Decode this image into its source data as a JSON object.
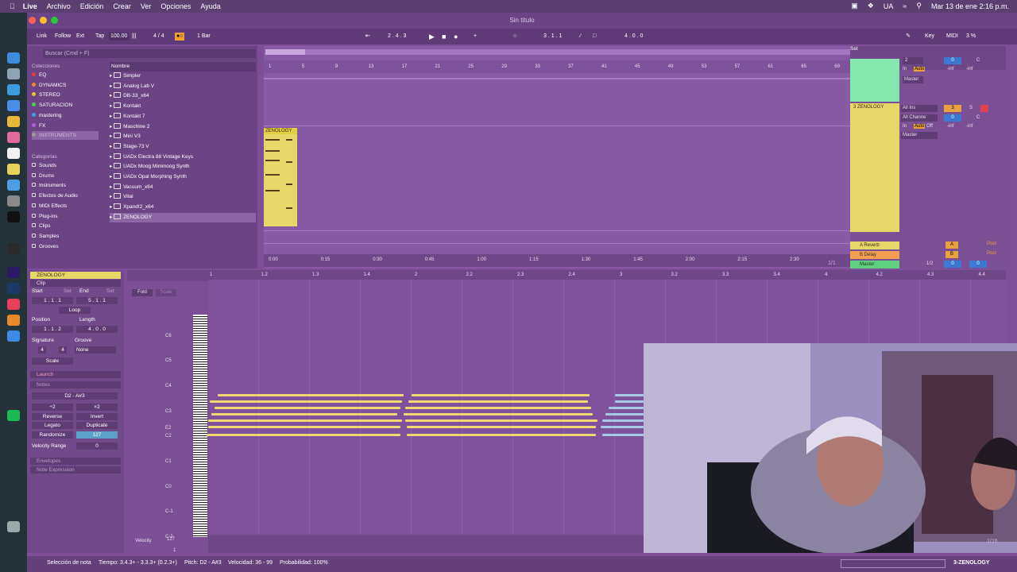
{
  "menubar": {
    "app": "Live",
    "items": [
      "Archivo",
      "Edición",
      "Crear",
      "Ver",
      "Opciones",
      "Ayuda"
    ],
    "status_lang": "UA",
    "datetime": "Mar 13 de ene  2:16 p.m."
  },
  "window": {
    "title": "Sin título"
  },
  "transport": {
    "link": "Link",
    "follow": "Follow",
    "ext": "Ext",
    "tap": "Tap",
    "tempo": "100.00",
    "signature": "4 / 4",
    "quantize": "1 Bar",
    "position": "2 .  4 .  3",
    "loop_start": "3 .  1 .  1",
    "loop_length": "4 .  0 .  0",
    "key": "Key",
    "midi": "MIDI",
    "cpu": "3 %"
  },
  "browser": {
    "search_placeholder": "Buscar (Cmd + F)",
    "collections_title": "Colecciones",
    "collections": [
      {
        "label": "EQ",
        "color": "#e43b3b"
      },
      {
        "label": "DYNAMICS",
        "color": "#f08a2a"
      },
      {
        "label": "STEREO",
        "color": "#e8c92a"
      },
      {
        "label": "SATURACION",
        "color": "#4ccf4c"
      },
      {
        "label": "mastering",
        "color": "#3aa0e8"
      },
      {
        "label": "FX",
        "color": "#b05ce0"
      },
      {
        "label": "INSTRUMENTS",
        "color": "#999999"
      }
    ],
    "categories_title": "Categorías",
    "categories": [
      "Sounds",
      "Drums",
      "Instruments",
      "Efectos de Audio",
      "MIDI Effects",
      "Plug-ins",
      "Clips",
      "Samples",
      "Grooves"
    ],
    "name_header": "Nombre",
    "items": [
      "Simpler",
      "Analog Lab V",
      "DB-33_x64",
      "Kontakt",
      "Kontakt 7",
      "Maschine 2",
      "Mini V3",
      "Stage-73 V",
      "UADx Electra 88 Vintage Keys",
      "UADx Moog Minimoog Synth",
      "UADx Opal Morphing Synth",
      "Vacuum_x64",
      "Vital",
      "Xpand!2_x64",
      "ZENOLOGY"
    ]
  },
  "arrangement": {
    "bar_numbers": [
      "1",
      "5",
      "9",
      "13",
      "17",
      "21",
      "25",
      "29",
      "33",
      "37",
      "41",
      "45",
      "49",
      "53",
      "57",
      "61",
      "65",
      "69"
    ],
    "clip_name": "ZENOLOGY",
    "time_labels": [
      "0:00",
      "0:15",
      "0:30",
      "0:45",
      "1:00",
      "1:15",
      "1:30",
      "1:45",
      "2:00",
      "2:15",
      "2:30"
    ],
    "set_label": "Set",
    "page": "1/1"
  },
  "mixer": {
    "track2": {
      "num": "2",
      "out": "Master",
      "in": "In",
      "auto": "Auto",
      "off": "Off",
      "vol": "0",
      "pan": "C",
      "inf1": "-inf",
      "inf2": "-inf"
    },
    "track3": {
      "name": "3 ZENOLOGY",
      "input": "All Ins",
      "channel": "All Channe",
      "out": "Master",
      "num": "3",
      "solo": "S",
      "vol": "0",
      "pan": "C",
      "in": "In",
      "auto": "Auto",
      "off": "Off",
      "inf1": "-inf",
      "inf2": "-inf"
    },
    "returns": [
      {
        "name": "A Reverb",
        "letter": "A",
        "post": "Post"
      },
      {
        "name": "B Delay",
        "letter": "B",
        "post": "Post"
      }
    ],
    "master": {
      "name": "Master",
      "ratio": "1/2",
      "vol": "0",
      "pan": "0"
    }
  },
  "clip": {
    "name": "ZENOLOGY",
    "section": "Clip",
    "start": "Start",
    "end": "End",
    "set": "Set",
    "start_val": "1 .  1 .  1",
    "end_val": "5 .  1 .  1",
    "loop": "Loop",
    "position": "Position",
    "length": "Length",
    "pos_val": "1 .  1 .  2",
    "len_val": "4 .  0 .  0",
    "signature": "Signature",
    "groove": "Groove",
    "sig_num": "4",
    "sig_den": "4",
    "groove_val": "None",
    "scale": "Scale",
    "launch": "Launch",
    "notes": "Notes",
    "range": "D2 - A#3",
    "plus2": "÷2",
    "times2": "×2",
    "reverse": "Reverse",
    "invert": "Invert",
    "legato": "Legato",
    "duplicate": "Duplicate",
    "randomize": "Randomize",
    "rand_val": "127",
    "vel_range": "Velocity Range",
    "vel_val": "0",
    "envelopes": "Envelopes",
    "note_expr": "Note Expression"
  },
  "midi": {
    "fold": "Fold",
    "scale": "Scale",
    "beats": [
      "1",
      "1.2",
      "1.3",
      "1.4",
      "2",
      "2.2",
      "2.3",
      "2.4",
      "3",
      "3.2",
      "3.3",
      "3.4",
      "4",
      "4.2",
      "4.3",
      "4.4",
      "5"
    ],
    "pitch_labels": [
      "C6",
      "C5",
      "C4",
      "C3",
      "E2",
      "C2",
      "C1",
      "C0",
      "C-1",
      "C-2"
    ],
    "velocity_label": "Velocity",
    "vel_max": "127",
    "vel_min": "1",
    "page": "1/16"
  },
  "status": {
    "selection": "Selección de nota",
    "time": "Tiempo: 3.4.3+ - 3.3.3+ (0.2.3+)",
    "pitch": "Pitch: D2 - A#3",
    "velocity": "Velocidad: 36 - 99",
    "prob": "Probabilidad: 100%",
    "track": "3-ZENOLOGY"
  }
}
